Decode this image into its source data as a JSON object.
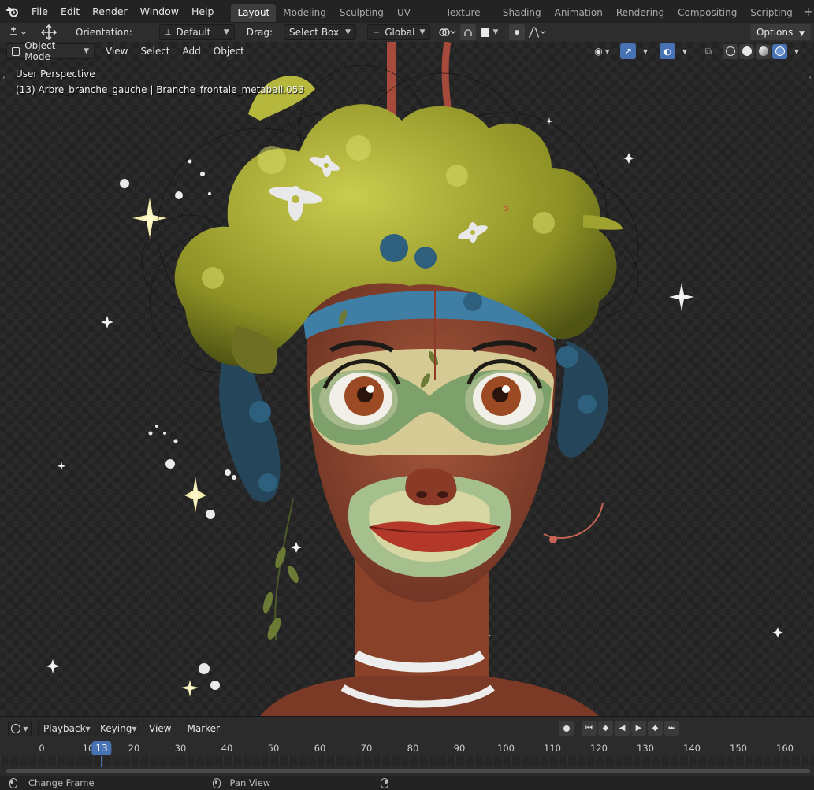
{
  "menubar": {
    "items": [
      "File",
      "Edit",
      "Render",
      "Window",
      "Help"
    ],
    "workspaces": [
      "Layout",
      "Modeling",
      "Sculpting",
      "UV Editing",
      "Texture Paint",
      "Shading",
      "Animation",
      "Rendering",
      "Compositing",
      "Scripting"
    ],
    "active_workspace": "Layout",
    "add_tab": "+"
  },
  "toolheader": {
    "orientation_label": "Orientation:",
    "orientation_value": "Default",
    "drag_label": "Drag:",
    "drag_value": "Select Box",
    "transform_space": "Global",
    "options": "Options"
  },
  "viewport": {
    "mode": "Object Mode",
    "menus": [
      "View",
      "Select",
      "Add",
      "Object"
    ],
    "perspective": "User Perspective",
    "active_object": "(13) Arbre_branche_gauche | Branche_frontale_metaball.053",
    "accent": "#4772b3"
  },
  "timeline": {
    "playback": "Playback",
    "keying": "Keying",
    "view": "View",
    "marker": "Marker",
    "ticks": [
      0,
      10,
      20,
      30,
      40,
      50,
      60,
      70,
      80,
      90,
      100,
      110,
      120,
      130,
      140,
      150,
      160
    ],
    "current_frame": "13"
  },
  "statusbar": {
    "left_action": "Change Frame",
    "middle_action": "Pan View"
  }
}
